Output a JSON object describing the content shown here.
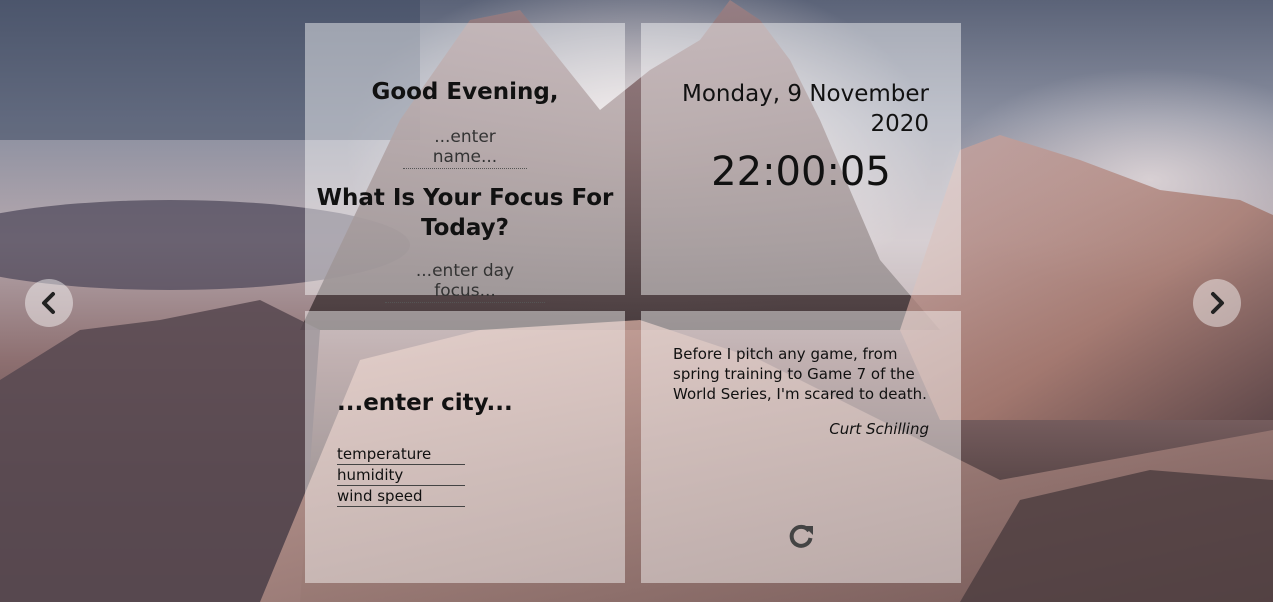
{
  "greeting": {
    "text": "Good Evening,",
    "name_placeholder": "...enter name...",
    "focus_question": "What Is Your Focus For Today?",
    "focus_placeholder": "...enter day focus..."
  },
  "datetime": {
    "date": "Monday, 9 November 2020",
    "time": "22:00:05"
  },
  "weather": {
    "city_placeholder": "...enter city...",
    "temperature_label": "temperature",
    "humidity_label": "humidity",
    "wind_label": "wind speed"
  },
  "quote": {
    "text": "Before I pitch any game, from spring training to Game 7 of the World Series, I'm scared to death.",
    "author": "Curt Schilling",
    "refresh_icon": "refresh-icon"
  },
  "navigation": {
    "prev_icon": "chevron-left-icon",
    "next_icon": "chevron-right-icon"
  }
}
